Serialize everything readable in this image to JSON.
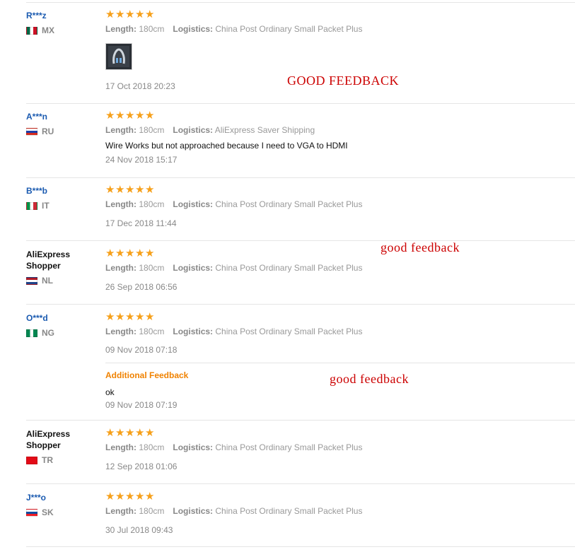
{
  "labels": {
    "length": "Length:",
    "logistics": "Logistics:",
    "additional_feedback": "Additional Feedback"
  },
  "colors": {
    "star": "#f6a01a",
    "user_link": "#1a5ab0",
    "additional_feedback": "#f08200",
    "annotation": "#cc0000"
  },
  "reviews": [
    {
      "user": "R***z",
      "country": "MX",
      "flag": "mexico-flag-icon",
      "rating": 5,
      "length": "180cm",
      "logistics": "China Post Ordinary Small Packet Plus",
      "image": "cable-photo-thumbnail",
      "date": "17 Oct 2018 20:23"
    },
    {
      "user": "A***n",
      "country": "RU",
      "flag": "russia-flag-icon",
      "rating": 5,
      "length": "180cm",
      "logistics": "AliExpress Saver Shipping",
      "comment": "Wire Works but not approached because I need to VGA to HDMI",
      "date": "24 Nov 2018 15:17"
    },
    {
      "user": "B***b",
      "country": "IT",
      "flag": "italy-flag-icon",
      "rating": 5,
      "length": "180cm",
      "logistics": "China Post Ordinary Small Packet Plus",
      "date": "17 Dec 2018 11:44"
    },
    {
      "user": "AliExpress Shopper",
      "country": "NL",
      "flag": "netherlands-flag-icon",
      "rating": 5,
      "length": "180cm",
      "logistics": "China Post Ordinary Small Packet Plus",
      "date": "26 Sep 2018 06:56"
    },
    {
      "user": "O***d",
      "country": "NG",
      "flag": "nigeria-flag-icon",
      "rating": 5,
      "length": "180cm",
      "logistics": "China Post Ordinary Small Packet Plus",
      "date": "09 Nov 2018 07:18",
      "additional_comment": "ok",
      "additional_date": "09 Nov 2018 07:19"
    },
    {
      "user": "AliExpress Shopper",
      "country": "TR",
      "flag": "turkey-flag-icon",
      "rating": 5,
      "length": "180cm",
      "logistics": "China Post Ordinary Small Packet Plus",
      "date": "12 Sep 2018 01:06"
    },
    {
      "user": "J***o",
      "country": "SK",
      "flag": "slovakia-flag-icon",
      "rating": 5,
      "length": "180cm",
      "logistics": "China Post Ordinary Small Packet Plus",
      "date": "30 Jul 2018 09:43"
    }
  ],
  "annotations": [
    "GOOD FEEDBACK",
    "good feedback",
    "good feedback"
  ]
}
